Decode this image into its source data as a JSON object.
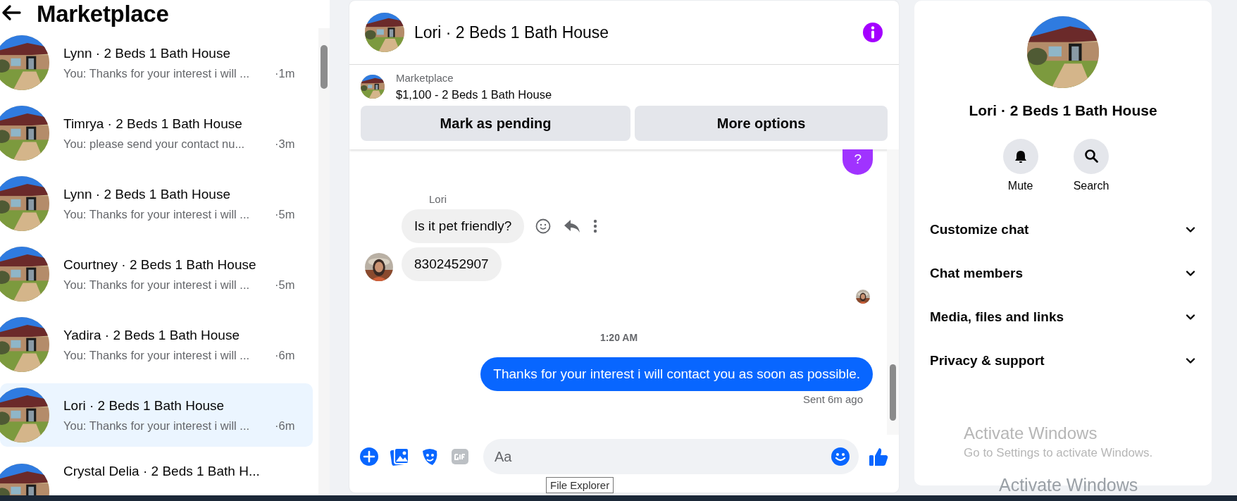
{
  "sidebar": {
    "title": "Marketplace",
    "conversations": [
      {
        "name": "Lynn · 2 Beds 1 Bath House",
        "preview": "You: Thanks for your interest i will ...",
        "time": "·1m",
        "selected": false
      },
      {
        "name": "Timrya · 2 Beds 1 Bath House",
        "preview": "You: please send your contact nu...",
        "time": "·3m",
        "selected": false
      },
      {
        "name": "Lynn · 2 Beds 1 Bath House",
        "preview": "You: Thanks for your interest i will ...",
        "time": "·5m",
        "selected": false
      },
      {
        "name": "Courtney · 2 Beds 1 Bath House",
        "preview": "You: Thanks for your interest i will ...",
        "time": "·5m",
        "selected": false
      },
      {
        "name": "Yadira · 2 Beds 1 Bath House",
        "preview": "You: Thanks for your interest i will ...",
        "time": "·6m",
        "selected": false
      },
      {
        "name": "Lori · 2 Beds 1 Bath House",
        "preview": "You: Thanks for your interest i will ...",
        "time": "·6m",
        "selected": true
      },
      {
        "name": "Crystal Delia · 2 Beds 1 Bath H...",
        "selected": false
      }
    ]
  },
  "chat": {
    "title": "Lori · 2 Beds 1 Bath House",
    "listing": {
      "label": "Marketplace",
      "title": "$1,100 - 2 Beds 1 Bath House"
    },
    "actions": [
      "Mark as pending",
      "More options"
    ],
    "messages": [
      {
        "kind": "sent",
        "text": "?",
        "color": "#a033ff"
      },
      {
        "kind": "name",
        "text": "Lori"
      },
      {
        "kind": "received",
        "text": "Is it pet friendly?",
        "hover": true,
        "avatar": false
      },
      {
        "kind": "received",
        "text": "8302452907",
        "hover": false,
        "avatar": true
      },
      {
        "kind": "seen"
      },
      {
        "kind": "time",
        "text": "1:20 AM"
      },
      {
        "kind": "sent",
        "text": "Thanks for your interest i will contact you as soon as possible.",
        "color": "#0866ff"
      },
      {
        "kind": "status",
        "text": "Sent 6m ago"
      }
    ],
    "composer": {
      "placeholder": "Aa"
    }
  },
  "details": {
    "title": "Lori · 2 Beds 1 Bath House",
    "buttons": [
      {
        "kind": "mute",
        "label": "Mute"
      },
      {
        "kind": "search",
        "label": "Search"
      }
    ],
    "sections": [
      {
        "label": "Customize chat",
        "expanded": false
      },
      {
        "label": "Chat members",
        "expanded": false
      },
      {
        "label": "Media, files and links",
        "expanded": false
      },
      {
        "label": "Privacy & support",
        "expanded": false
      }
    ]
  },
  "tooltip": "File Explorer",
  "windows_notice": {
    "title": "Activate Windows",
    "text": "Go to Settings to activate Windows.",
    "repeat": "Activate Windows"
  }
}
